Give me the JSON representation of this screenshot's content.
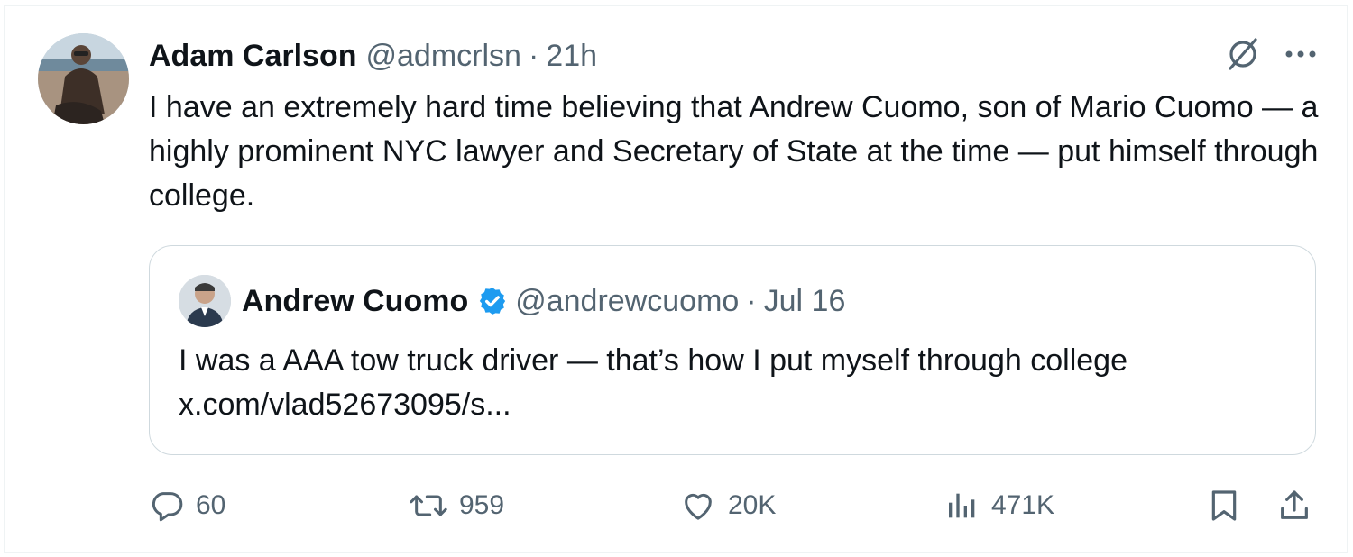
{
  "post": {
    "author_name": "Adam Carlson",
    "author_handle": "@admcrlsn",
    "separator": "·",
    "time": "21h",
    "text": "I have an extremely hard time believing that Andrew Cuomo, son of Mario Cuomo — a highly prominent NYC lawyer and Secretary of State at the time — put himself through college.",
    "icons": [
      "grok-icon",
      "more-icon"
    ]
  },
  "quoted_post": {
    "author_name": "Andrew Cuomo",
    "verified": true,
    "author_handle": "@andrewcuomo",
    "separator": "·",
    "date": "Jul 16",
    "text": "I was a AAA tow truck driver — that’s how I put myself through college",
    "link": "x.com/vlad52673095/s..."
  },
  "actions": {
    "replies": "60",
    "reposts": "959",
    "likes": "20K",
    "views": "471K",
    "icons": [
      "reply-icon",
      "repost-icon",
      "like-icon",
      "views-icon",
      "bookmark-icon",
      "share-icon"
    ]
  },
  "colors": {
    "text_primary": "#0f1419",
    "text_secondary": "#536471",
    "border": "#cfd9de",
    "verified_blue": "#1d9bf0"
  }
}
